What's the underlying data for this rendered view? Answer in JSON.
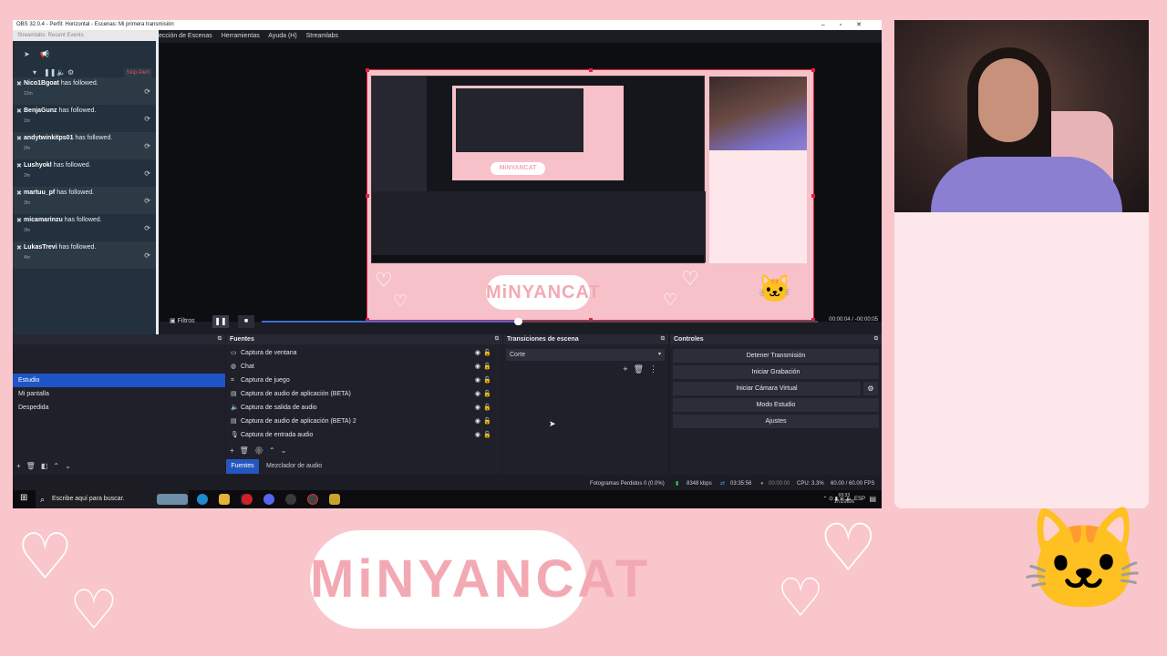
{
  "window": {
    "title": "OBS 32.0.4 - Perfil: Horizontal - Escenas: Mi primera transmisión",
    "controls": [
      "–",
      "▫",
      "✕"
    ]
  },
  "menu": [
    "ección de Escenas",
    "Herramientas",
    "Ayuda (H)",
    "Streamlabs"
  ],
  "preview": {
    "inner_logo": "MiNYANCAT",
    "canvas_logo": "MiNYANCAT"
  },
  "alerts": {
    "header": "Streamlabs: Recent Events",
    "skip_label": "Skip Alert",
    "items": [
      {
        "user": "Nico1Bgoat",
        "action": "has followed.",
        "ago": "12m"
      },
      {
        "user": "BenjaGunz",
        "action": "has followed.",
        "ago": "1hr"
      },
      {
        "user": "andytwinkitps01",
        "action": "has followed.",
        "ago": "2hr"
      },
      {
        "user": "Lushyokl",
        "action": "has followed.",
        "ago": "2hr"
      },
      {
        "user": "martuu_pf",
        "action": "has followed.",
        "ago": "3hr"
      },
      {
        "user": "micamarinzu",
        "action": "has followed.",
        "ago": "3hr"
      },
      {
        "user": "LukasTrevi",
        "action": "has followed.",
        "ago": "4hr"
      }
    ]
  },
  "playback": {
    "filters_label": "Filtros",
    "time": "00:00:04 / -00:00:05",
    "progress": 0.46
  },
  "scenes": {
    "items": [
      "Estudio",
      "Mi pantalla",
      "Despedida"
    ],
    "selected": "Estudio"
  },
  "sources": {
    "title": "Fuentes",
    "items": [
      {
        "name": "Captura de ventana",
        "icon": "window-icon"
      },
      {
        "name": "Chat",
        "icon": "globe-icon"
      },
      {
        "name": "Captura de juego",
        "icon": "gamepad-icon"
      },
      {
        "name": "Captura de audio de aplicación (BETA)",
        "icon": "app-audio-icon"
      },
      {
        "name": "Captura de salida de audio",
        "icon": "speaker-icon"
      },
      {
        "name": "Captura de audio de aplicación (BETA) 2",
        "icon": "app-audio-icon"
      },
      {
        "name": "Captura de entrada audio",
        "icon": "mic-icon"
      }
    ],
    "tab_sources": "Fuentes",
    "tab_mixer": "Mezclador de audio"
  },
  "transitions": {
    "title": "Transiciones de escena",
    "selected": "Corte"
  },
  "controls": {
    "title": "Controles",
    "stop_stream": "Detener Transmisión",
    "start_recording": "Iniciar Grabación",
    "start_virtual_cam": "Iniciar Cámara Virtual",
    "studio_mode": "Modo Estudio",
    "settings": "Ajustes"
  },
  "status": {
    "dropped_frames": "Fotogramas Perdidos 0 (0.0%)",
    "bitrate": "8348 kbps",
    "stream_time": "03:35:56",
    "rec_time": "00:00:00",
    "cpu": "CPU: 3.3%",
    "fps": "60.00 / 60.00 FPS"
  },
  "taskbar": {
    "search_placeholder": "Escribe aquí para buscar.",
    "language": "ESP",
    "time": "03:33",
    "date": "17/2/2026"
  },
  "branding": {
    "logo": "MiNYANCAT"
  },
  "colors": {
    "background": "#f9c6cc",
    "accent_pink": "#f3a9b3",
    "obs_selected": "#1e54c8",
    "preview_border": "#e02040"
  }
}
